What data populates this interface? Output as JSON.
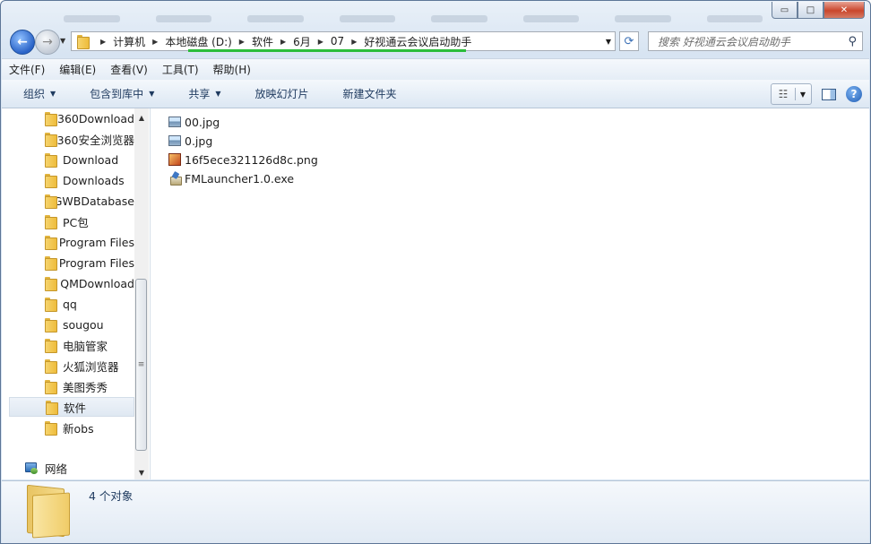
{
  "window": {
    "controls": {
      "minimize": "▭",
      "maximize": "□",
      "close": "✕"
    }
  },
  "address": {
    "crumbs": [
      "计算机",
      "本地磁盘 (D:)",
      "软件",
      "6月",
      "07",
      "好视通云会议启动助手"
    ]
  },
  "search": {
    "placeholder": "搜索 好视通云会议启动助手"
  },
  "menu": [
    "文件(F)",
    "编辑(E)",
    "查看(V)",
    "工具(T)",
    "帮助(H)"
  ],
  "toolbar": {
    "organize": "组织",
    "include_library": "包含到库中",
    "share": "共享",
    "slideshow": "放映幻灯片",
    "new_folder": "新建文件夹"
  },
  "nav": {
    "folders": [
      "360Download",
      "360安全浏览器",
      "Download",
      "Downloads",
      "GWBDatabase",
      "PC包",
      "Program Files",
      "Program Files",
      "QMDownload",
      "qq",
      "sougou",
      "电脑管家",
      "火狐浏览器",
      "美图秀秀",
      "软件",
      "新obs"
    ],
    "selected": "软件",
    "network": "网络"
  },
  "files": [
    {
      "name": "00.jpg",
      "icon": "jpg-image-icon"
    },
    {
      "name": "0.jpg",
      "icon": "jpg-image-icon"
    },
    {
      "name": "16f5ece321126d8c.png",
      "icon": "png-image-icon"
    },
    {
      "name": "FMLauncher1.0.exe",
      "icon": "exe-app-icon"
    }
  ],
  "details": {
    "count": "4 个对象"
  }
}
